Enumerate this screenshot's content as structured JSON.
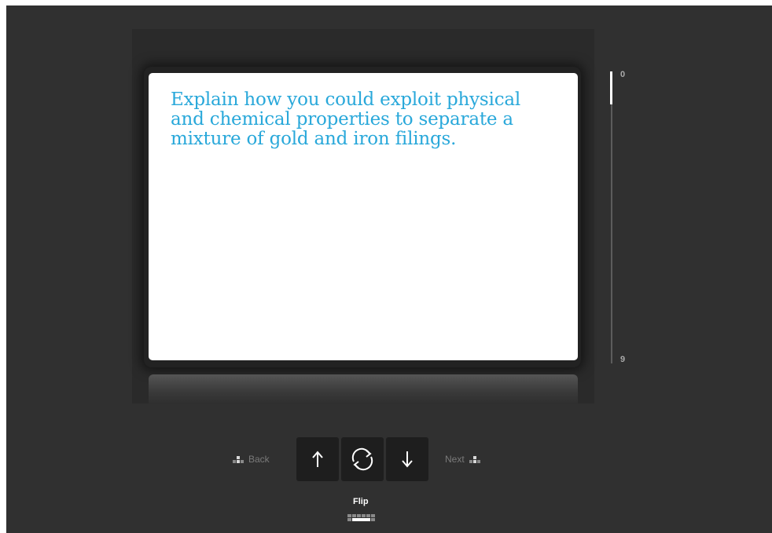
{
  "card": {
    "question": "Explain how you could exploit physical and chemical properties to separate a mixture of gold and iron filings."
  },
  "progress": {
    "start_label": "0",
    "end_label": "9"
  },
  "controls": {
    "back_label": "Back",
    "next_label": "Next",
    "flip_label": "Flip",
    "up_icon": "arrow-up-icon",
    "flip_icon": "flip-rotate-icon",
    "down_icon": "arrow-down-icon"
  },
  "colors": {
    "card_text": "#29a8da",
    "background": "#303030",
    "card": "#ffffff"
  }
}
